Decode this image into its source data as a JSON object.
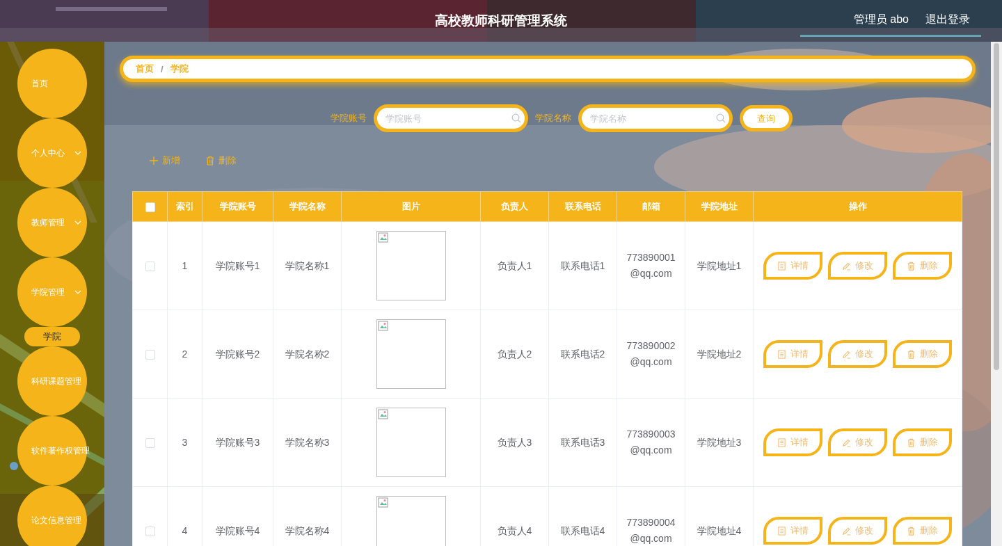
{
  "header": {
    "title": "高校教师科研管理系统",
    "user": "管理员 abo",
    "logout": "退出登录"
  },
  "sidebar": {
    "items": [
      {
        "label": "首页",
        "expandable": false
      },
      {
        "label": "个人中心",
        "expandable": true,
        "expanded": false
      },
      {
        "label": "教师管理",
        "expandable": true,
        "expanded": false
      },
      {
        "label": "学院管理",
        "expandable": true,
        "expanded": true,
        "children": [
          {
            "label": "学院"
          }
        ]
      },
      {
        "label": "科研课题管理",
        "expandable": false
      },
      {
        "label": "软件著作权管理",
        "expandable": false
      },
      {
        "label": "论文信息管理",
        "expandable": false
      }
    ]
  },
  "breadcrumb": {
    "items": [
      "首页",
      "学院"
    ],
    "separator": "/"
  },
  "search": {
    "fields": [
      {
        "label": "学院账号",
        "placeholder": "学院账号"
      },
      {
        "label": "学院名称",
        "placeholder": "学院名称"
      }
    ],
    "button": "查询"
  },
  "actions": [
    {
      "kind": "add",
      "label": "新增"
    },
    {
      "kind": "delete",
      "label": "删除"
    }
  ],
  "table": {
    "header_checked": false,
    "columns": [
      "索引",
      "学院账号",
      "学院名称",
      "图片",
      "负责人",
      "联系电话",
      "邮箱",
      "学院地址",
      "操作"
    ],
    "rows": [
      {
        "selected": false,
        "index": "1",
        "account": "学院账号1",
        "name": "学院名称1",
        "head": "负责人1",
        "phone": "联系电话1",
        "email": "773890001@qq.com",
        "address": "学院地址1",
        "actions": [
          {
            "kind": "detail",
            "label": "详情"
          },
          {
            "kind": "edit",
            "label": "修改"
          },
          {
            "kind": "delete",
            "label": "删除"
          }
        ]
      },
      {
        "selected": false,
        "index": "2",
        "account": "学院账号2",
        "name": "学院名称2",
        "head": "负责人2",
        "phone": "联系电话2",
        "email": "773890002@qq.com",
        "address": "学院地址2",
        "actions": [
          {
            "kind": "detail",
            "label": "详情"
          },
          {
            "kind": "edit",
            "label": "修改"
          },
          {
            "kind": "delete",
            "label": "删除"
          }
        ]
      },
      {
        "selected": false,
        "index": "3",
        "account": "学院账号3",
        "name": "学院名称3",
        "head": "负责人3",
        "phone": "联系电话3",
        "email": "773890003@qq.com",
        "address": "学院地址3",
        "actions": [
          {
            "kind": "detail",
            "label": "详情"
          },
          {
            "kind": "edit",
            "label": "修改"
          },
          {
            "kind": "delete",
            "label": "删除"
          }
        ]
      },
      {
        "selected": false,
        "index": "4",
        "account": "学院账号4",
        "name": "学院名称4",
        "head": "负责人4",
        "phone": "联系电话4",
        "email": "773890004@qq.com",
        "address": "学院地址4",
        "actions": [
          {
            "kind": "detail",
            "label": "详情"
          },
          {
            "kind": "edit",
            "label": "修改"
          },
          {
            "kind": "delete",
            "label": "删除"
          }
        ]
      }
    ]
  }
}
